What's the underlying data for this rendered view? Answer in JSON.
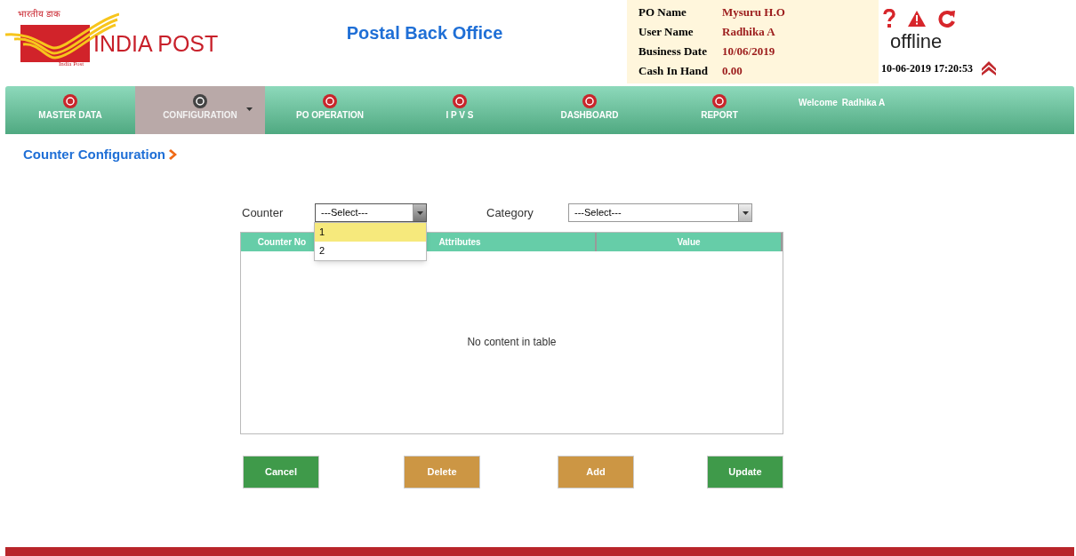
{
  "header": {
    "logo": {
      "script_text": "भारतीय डाक",
      "name": "INDIA POST",
      "caption": "India Post"
    },
    "title": "Postal Back Office",
    "info": [
      {
        "label": "PO Name",
        "value": "Mysuru H.O"
      },
      {
        "label": "User Name",
        "value": "Radhika A"
      },
      {
        "label": "Business Date",
        "value": "10/06/2019"
      },
      {
        "label": "Cash In Hand",
        "value": "0.00"
      }
    ],
    "connection": "offline",
    "datetime": "10-06-2019 17:20:53"
  },
  "nav": {
    "items": [
      {
        "label": "MASTER DATA",
        "selected": false
      },
      {
        "label": "CONFIGURATION",
        "selected": true
      },
      {
        "label": "PO OPERATION",
        "selected": false
      },
      {
        "label": "I P V S",
        "selected": false
      },
      {
        "label": "DASHBOARD",
        "selected": false
      },
      {
        "label": "REPORT",
        "selected": false
      }
    ],
    "welcome": "Welcome",
    "user": "Radhika A"
  },
  "breadcrumb": "Counter Configuration",
  "filters": [
    {
      "label": "Counter",
      "value": "---Select---",
      "expanded": true,
      "options": [
        {
          "label": "1",
          "selected": true
        },
        {
          "label": "2",
          "selected": false
        }
      ]
    },
    {
      "label": "Category",
      "value": "---Select---",
      "expanded": false
    }
  ],
  "table": {
    "columns": [
      "Counter No",
      "Attributes",
      "Value"
    ],
    "empty_message": "No content in table"
  },
  "buttons": [
    {
      "label": "Cancel",
      "kind": "green"
    },
    {
      "label": "Delete",
      "kind": "orange"
    },
    {
      "label": "Add",
      "kind": "orange"
    },
    {
      "label": "Update",
      "kind": "green"
    }
  ]
}
